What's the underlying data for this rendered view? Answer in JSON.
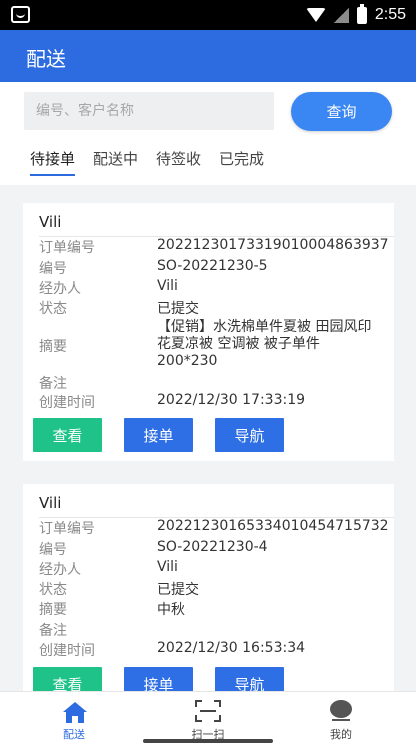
{
  "status_bar": {
    "time": "2:55"
  },
  "app_bar": {
    "title": "配送"
  },
  "search": {
    "placeholder": "编号、客户名称",
    "button_label": "查询"
  },
  "tabs": [
    {
      "label": "待接单",
      "active": true
    },
    {
      "label": "配送中",
      "active": false
    },
    {
      "label": "待签收",
      "active": false
    },
    {
      "label": "已完成",
      "active": false
    }
  ],
  "labels": {
    "order_no": "订单编号",
    "code": "编号",
    "handler": "经办人",
    "status": "状态",
    "summary": "摘要",
    "remark": "备注",
    "created": "创建时间"
  },
  "buttons": {
    "view": "查看",
    "accept": "接单",
    "navigate": "导航"
  },
  "orders": [
    {
      "customer": "Vili",
      "order_no": "20221230173319010004863937",
      "code": "SO-20221230-5",
      "handler": "Vili",
      "status": "已提交",
      "summary": "【促销】水洗棉单件夏被 田园风印花夏凉被 空调被 被子单件200*230",
      "remark": "",
      "created": "2022/12/30 17:33:19"
    },
    {
      "customer": "Vili",
      "order_no": "20221230165334010454715732",
      "code": "SO-20221230-4",
      "handler": "Vili",
      "status": "已提交",
      "summary": "中秋",
      "remark": "",
      "created": "2022/12/30 16:53:34"
    }
  ],
  "bottom_nav": [
    {
      "label": "配送",
      "icon": "home-icon",
      "active": true
    },
    {
      "label": "扫一扫",
      "icon": "scan-icon",
      "active": false
    },
    {
      "label": "我的",
      "icon": "user-icon",
      "active": false
    }
  ],
  "colors": {
    "primary": "#2d6be0",
    "view_button": "#1fc38a",
    "action_button": "#2e6fe6"
  }
}
